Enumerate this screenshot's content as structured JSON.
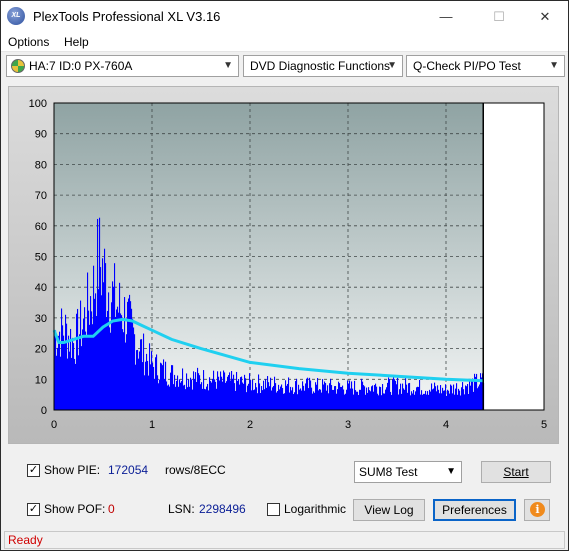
{
  "window": {
    "title": "PlexTools Professional XL V3.16",
    "icon_text": "XL",
    "controls": {
      "minimize": "—",
      "maximize": "☐",
      "close": "✕"
    }
  },
  "menu": {
    "options": "Options",
    "help": "Help"
  },
  "toolbar": {
    "drive": "HA:7 ID:0  PX-760A",
    "function": "DVD Diagnostic Functions",
    "test": "Q-Check PI/PO Test"
  },
  "chart_data": {
    "type": "bar",
    "x_range": [
      0,
      5
    ],
    "y_range": [
      0,
      100
    ],
    "x_ticks": [
      "0",
      "1",
      "2",
      "3",
      "4",
      "5"
    ],
    "y_ticks": [
      "0",
      "10",
      "20",
      "30",
      "40",
      "50",
      "60",
      "70",
      "80",
      "90",
      "100"
    ],
    "end_marker_x": 4.38,
    "grid": true,
    "colors": {
      "bars": "#0000ff",
      "line": "#1fd0f0",
      "plot_bg_top": "#8fa3a3",
      "plot_bg_bottom": "#f4f6f6",
      "marker": "#000000"
    },
    "series": [
      {
        "kind": "bars",
        "x": [
          0.0,
          0.1,
          0.2,
          0.3,
          0.4,
          0.45,
          0.5,
          0.55,
          0.6,
          0.65,
          0.7,
          0.75,
          0.8,
          0.9,
          1.0,
          1.2,
          1.5,
          2.0,
          2.5,
          3.0,
          3.5,
          4.0,
          4.38
        ],
        "values": [
          34,
          36,
          30,
          40,
          54,
          68,
          62,
          55,
          50,
          46,
          44,
          40,
          34,
          26,
          20,
          16,
          14,
          12,
          11,
          10,
          11,
          9,
          13
        ]
      },
      {
        "kind": "line",
        "x": [
          0.0,
          0.05,
          0.1,
          0.2,
          0.3,
          0.4,
          0.5,
          0.6,
          0.7,
          0.8,
          0.9,
          1.0,
          1.2,
          1.5,
          2.0,
          2.5,
          3.0,
          3.5,
          4.0,
          4.38
        ],
        "values": [
          26,
          22,
          22,
          23,
          24,
          24,
          27,
          29,
          29.5,
          29,
          27.5,
          26,
          23,
          20,
          15.5,
          13.5,
          12,
          11,
          10,
          9.5
        ]
      }
    ]
  },
  "bottom": {
    "show_pie_label": "Show PIE:",
    "pie_value": "172054",
    "pie_unit": "rows/8ECC",
    "show_pof_label": "Show POF:",
    "pof_value": "0",
    "lsn_label": "LSN:",
    "lsn_value": "2298496",
    "logarithmic_label": "Logarithmic",
    "sum8_select": "SUM8 Test",
    "start_button": "Start",
    "view_log_button": "View Log",
    "preferences_button": "Preferences",
    "info_icon_glyph": "i"
  },
  "status": {
    "text": "Ready"
  }
}
